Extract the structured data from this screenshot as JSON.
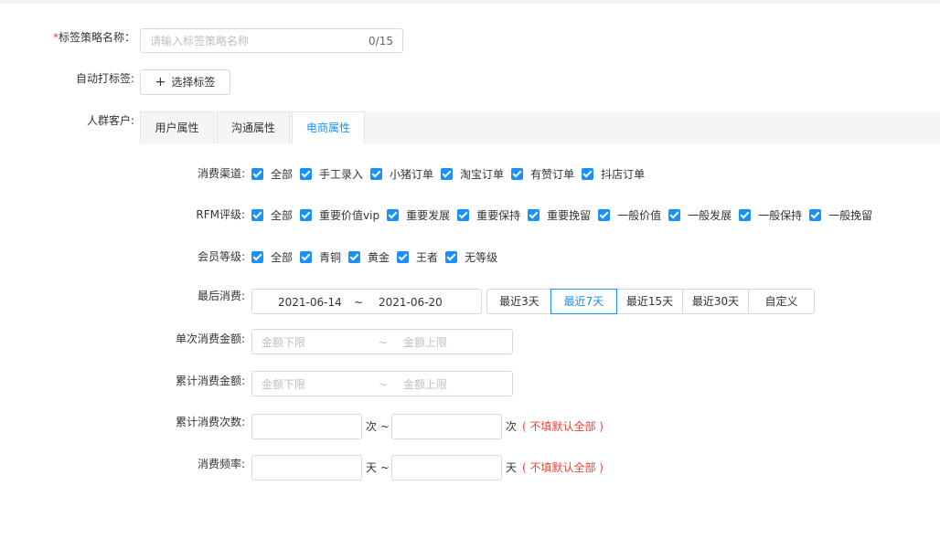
{
  "form": {
    "name_label": "标签策略名称：",
    "name_required": "*",
    "name_placeholder": "请输入标签策略名称",
    "name_counter": "0/15",
    "auto_tag_label": "自动打标签:",
    "select_tag_button": "选择标签",
    "crowd_label": "人群客户:"
  },
  "tabs": [
    {
      "label": "用户属性",
      "active": false
    },
    {
      "label": "沟通属性",
      "active": false
    },
    {
      "label": "电商属性",
      "active": true
    }
  ],
  "channel": {
    "label": "消费渠道:",
    "options": [
      "全部",
      "手工录入",
      "小猪订单",
      "淘宝订单",
      "有赞订单",
      "抖店订单"
    ]
  },
  "rfm": {
    "label": "RFM评级:",
    "options": [
      "全部",
      "重要价值vip",
      "重要发展",
      "重要保持",
      "重要挽留",
      "一般价值",
      "一般发展",
      "一般保持",
      "一般挽留"
    ]
  },
  "member": {
    "label": "会员等级:",
    "options": [
      "全部",
      "青铜",
      "黄金",
      "王者",
      "无等级"
    ]
  },
  "last_consume": {
    "label": "最后消费:",
    "start_date": "2021-06-14",
    "separator": "~",
    "end_date": "2021-06-20",
    "ranges": [
      "最近3天",
      "最近7天",
      "最近15天",
      "最近30天",
      "自定义"
    ],
    "active_range": "最近7天"
  },
  "single_amount": {
    "label": "单次消费金额:",
    "min_placeholder": "金额下限",
    "separator": "~",
    "max_placeholder": "金额上限"
  },
  "total_amount": {
    "label": "累计消费金额:",
    "min_placeholder": "金额下限",
    "separator": "~",
    "max_placeholder": "金额上限"
  },
  "total_count": {
    "label": "累计消费次数:",
    "unit_sep": "次 ~",
    "unit": "次",
    "hint": "( 不填默认全部 )"
  },
  "frequency": {
    "label": "消费频率:",
    "unit_sep": "天 ~",
    "unit": "天",
    "hint": "( 不填默认全部 )"
  },
  "colors": {
    "primary": "#1890ff",
    "danger": "#f04134",
    "border": "#d9d9d9"
  }
}
